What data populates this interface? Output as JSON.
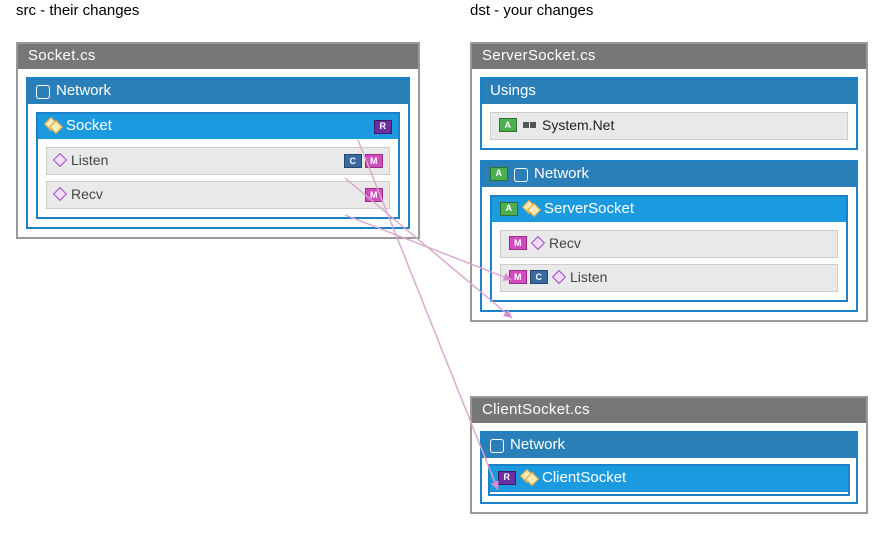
{
  "labels": {
    "src": "src - their changes",
    "dst": "dst - your changes"
  },
  "badges": {
    "R": "R",
    "C": "C",
    "M": "M",
    "A": "A"
  },
  "src_file": {
    "title": "Socket.cs",
    "namespace": "Network",
    "class": "Socket",
    "members": {
      "listen": "Listen",
      "recv": "Recv"
    }
  },
  "dst_file1": {
    "title": "ServerSocket.cs",
    "usings_title": "Usings",
    "using_item": "System.Net",
    "namespace": "Network",
    "class": "ServerSocket",
    "members": {
      "recv": "Recv",
      "listen": "Listen"
    }
  },
  "dst_file2": {
    "title": "ClientSocket.cs",
    "namespace": "Network",
    "class": "ClientSocket"
  }
}
